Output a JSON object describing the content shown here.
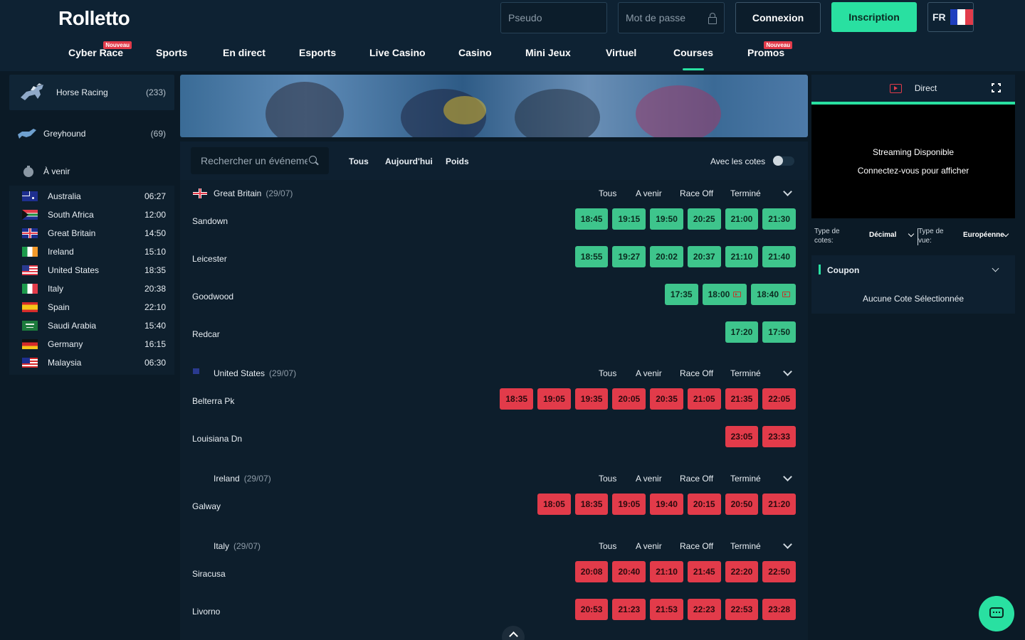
{
  "header": {
    "logo": "Rolletto",
    "pseudo_placeholder": "Pseudo",
    "password_placeholder": "Mot de passe",
    "login_label": "Connexion",
    "register_label": "Inscription",
    "lang": "FR"
  },
  "nav": [
    {
      "label": "Cyber Race",
      "badge": "Nouveau"
    },
    {
      "label": "Sports"
    },
    {
      "label": "En direct"
    },
    {
      "label": "Esports"
    },
    {
      "label": "Live Casino"
    },
    {
      "label": "Casino"
    },
    {
      "label": "Mini Jeux"
    },
    {
      "label": "Virtuel"
    },
    {
      "label": "Courses",
      "active": true
    },
    {
      "label": "Promos",
      "badge": "Nouveau"
    }
  ],
  "sidebar": {
    "sports": [
      {
        "label": "Horse Racing",
        "count": "(233)"
      },
      {
        "label": "Greyhound",
        "count": "(69)"
      }
    ],
    "upcoming_label": "À venir",
    "countries": [
      {
        "name": "Australia",
        "time": "06:27"
      },
      {
        "name": "South Africa",
        "time": "12:00"
      },
      {
        "name": "Great Britain",
        "time": "14:50"
      },
      {
        "name": "Ireland",
        "time": "15:10"
      },
      {
        "name": "United States",
        "time": "18:35"
      },
      {
        "name": "Italy",
        "time": "20:38"
      },
      {
        "name": "Spain",
        "time": "22:10"
      },
      {
        "name": "Saudi Arabia",
        "time": "15:40"
      },
      {
        "name": "Germany",
        "time": "16:15"
      },
      {
        "name": "Malaysia",
        "time": "06:30"
      }
    ]
  },
  "filters": {
    "search_placeholder": "Rechercher un événement",
    "tabs": [
      "Tous",
      "Aujourd'hui",
      "Poids"
    ],
    "odds_toggle_label": "Avec les cotes"
  },
  "section_tabs": [
    "Tous",
    "A venir",
    "Race Off",
    "Terminé"
  ],
  "sections": [
    {
      "country": "Great Britain",
      "date": "(29/07)",
      "meetings": [
        {
          "name": "Sandown",
          "status": "g",
          "times": [
            "18:45",
            "19:15",
            "19:50",
            "20:25",
            "21:00",
            "21:30"
          ]
        },
        {
          "name": "Leicester",
          "status": "g",
          "times": [
            "18:55",
            "19:27",
            "20:02",
            "20:37",
            "21:10",
            "21:40"
          ]
        },
        {
          "name": "Goodwood",
          "status": "g",
          "times": [
            "17:35",
            "18:00",
            "18:40"
          ]
        },
        {
          "name": "Redcar",
          "status": "g",
          "times": [
            "17:20",
            "17:50"
          ]
        }
      ]
    },
    {
      "country": "United States",
      "date": "(29/07)",
      "meetings": [
        {
          "name": "Belterra Pk",
          "status": "r",
          "times": [
            "18:35",
            "19:05",
            "19:35",
            "20:05",
            "20:35",
            "21:05",
            "21:35",
            "22:05"
          ]
        },
        {
          "name": "Louisiana Dn",
          "status": "r",
          "times": [
            "23:05",
            "23:33"
          ]
        }
      ]
    },
    {
      "country": "Ireland",
      "date": "(29/07)",
      "meetings": [
        {
          "name": "Galway",
          "status": "r",
          "times": [
            "18:05",
            "18:35",
            "19:05",
            "19:40",
            "20:15",
            "20:50",
            "21:20"
          ]
        }
      ]
    },
    {
      "country": "Italy",
      "date": "(29/07)",
      "meetings": [
        {
          "name": "Siracusa",
          "status": "r",
          "times": [
            "20:08",
            "20:40",
            "21:10",
            "21:45",
            "22:20",
            "22:50"
          ]
        },
        {
          "name": "Livorno",
          "status": "r",
          "times": [
            "20:53",
            "21:23",
            "21:53",
            "22:23",
            "22:53",
            "23:28"
          ]
        }
      ]
    }
  ],
  "right": {
    "live_label": "Direct",
    "stream_line1": "Streaming Disponible",
    "stream_line2": "Connectez-vous pour afficher",
    "odds_type_label": "Type de cotes:",
    "odds_type_value": "Décimal",
    "view_type_label": "Type de vue:",
    "view_type_value": "Européenne",
    "coupon_title": "Coupon",
    "coupon_empty": "Aucune Cote Sélectionnée"
  },
  "colors": {
    "accent": "#29e0a1",
    "open_race": "#3ec58c",
    "closed_race": "#e23b4a"
  }
}
